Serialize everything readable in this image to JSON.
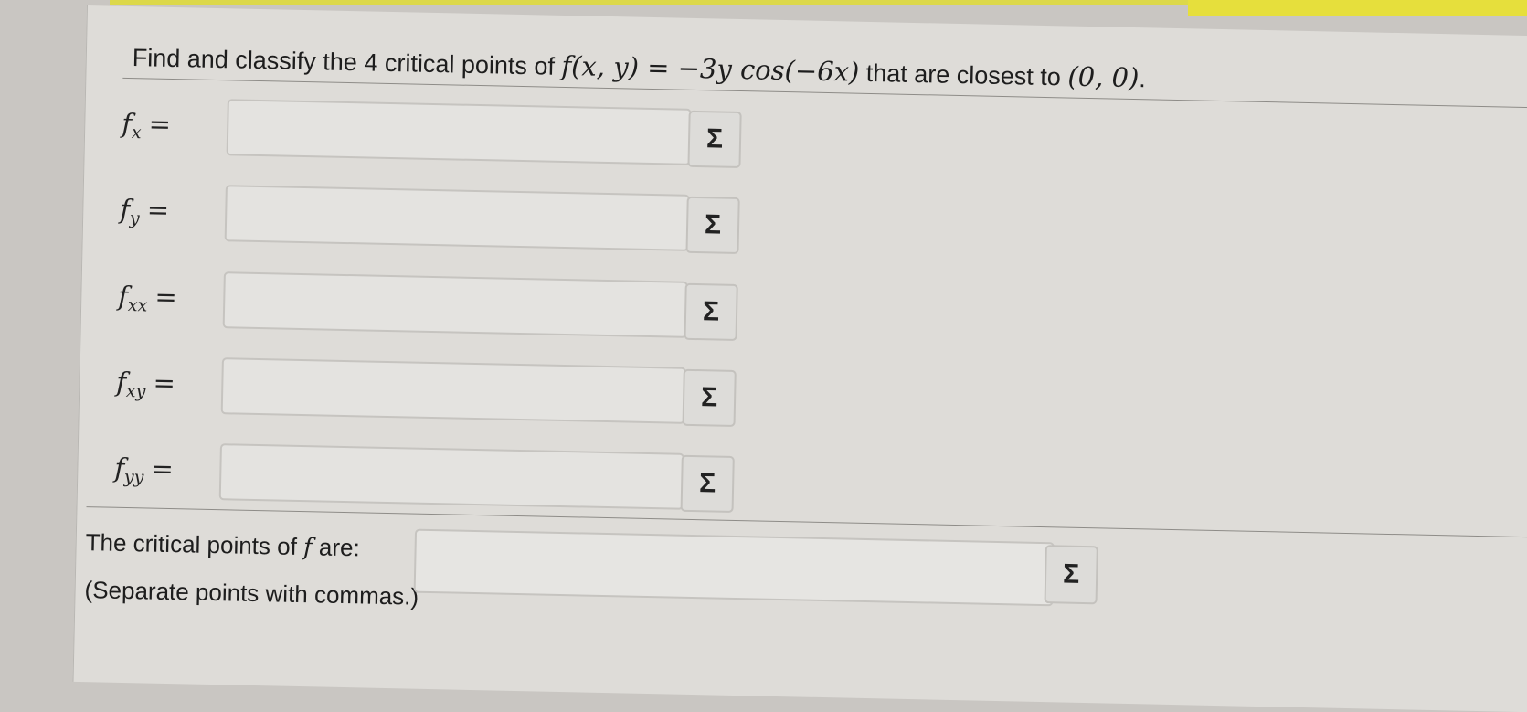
{
  "question": {
    "text_before": "Find and classify the 4 critical points of ",
    "function": "f(x, y) = −3y cos(−6x)",
    "text_after": " that are closest to ",
    "point": "(0, 0)",
    "period": "."
  },
  "derivatives": [
    {
      "name": "f",
      "sub": "x",
      "eq": "=",
      "value": "",
      "button": "Σ"
    },
    {
      "name": "f",
      "sub": "y",
      "eq": "=",
      "value": "",
      "button": "Σ"
    },
    {
      "name": "f",
      "sub": "xx",
      "eq": "=",
      "value": "",
      "button": "Σ"
    },
    {
      "name": "f",
      "sub": "xy",
      "eq": "=",
      "value": "",
      "button": "Σ"
    },
    {
      "name": "f",
      "sub": "yy",
      "eq": "=",
      "value": "",
      "button": "Σ"
    }
  ],
  "critical_points": {
    "label_before": "The critical points of ",
    "label_var": "f",
    "label_after": " are:",
    "note": "(Separate points with commas.)",
    "value": "",
    "button": "Σ"
  }
}
